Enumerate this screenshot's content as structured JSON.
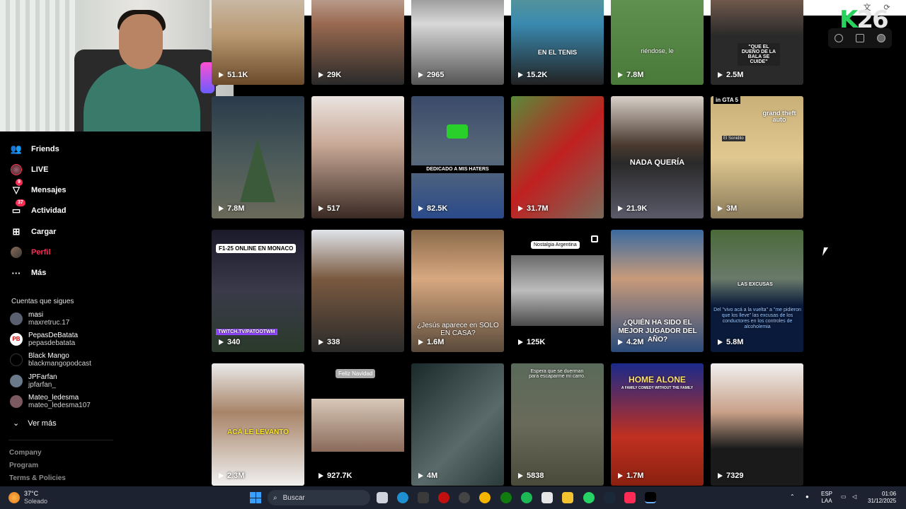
{
  "nav": {
    "friends": "Friends",
    "live": "LIVE",
    "messages": "Mensajes",
    "messages_badge": "9",
    "activity": "Actividad",
    "activity_badge": "37",
    "upload": "Cargar",
    "profile": "Perfil",
    "more": "Más"
  },
  "following": {
    "title": "Cuentas que sigues",
    "accounts": [
      {
        "name": "masi",
        "handle": "maxretruc.17"
      },
      {
        "name": "PepasDeBatata",
        "handle": "pepasdebatata"
      },
      {
        "name": "Black Mango",
        "handle": "blackmangopodcast"
      },
      {
        "name": "JPFarfan",
        "handle": "jpfarfan_"
      },
      {
        "name": "Mateo_ledesma",
        "handle": "mateo_ledesma107"
      }
    ],
    "see_more": "Ver más"
  },
  "footer": {
    "company": "Company",
    "program": "Program",
    "terms": "Terms & Policies"
  },
  "grid": {
    "row0": [
      "51.1K",
      "29K",
      "2965",
      "15.2K",
      "7.8M",
      "2.5M"
    ],
    "row1": [
      "7.8M",
      "517",
      "82.5K",
      "31.7M",
      "21.9K",
      "3M"
    ],
    "row2": [
      "340",
      "338",
      "1.6M",
      "125K",
      "4.2M",
      "5.8M"
    ],
    "row3": [
      "2.3M",
      "927.7K",
      "4M",
      "5838",
      "1.7M",
      "7329"
    ]
  },
  "captions": {
    "tenis": "EN EL TENIS",
    "riendose": "riéndose, le",
    "dueno": "\"QUE EL DUEÑO DE LA BALA SE CUIDE\"",
    "haters": "DEDICADO A MIS HATERS",
    "nada": "NADA QUERÍA",
    "gta": "in GTA 5",
    "gta_logo": "grand theft auto",
    "sonidito": "El Sonidito",
    "f1": "F1-25 ONLINE EN MONACO",
    "twitch": "TWITCH.TV/PATOOTWM",
    "jesus": "¿Jesús aparece en SOLO EN CASA?",
    "nostalgia": "Nostalgia Argentina",
    "quien": "¿QUIÉN HA SIDO EL MEJOR JUGADOR DEL AÑO?",
    "vivo": "Del \"vivo acá a la vuelta\" a \"me pidieron que los lleve\" las excusas de los conductores en los controles de alcoholemia",
    "excusas": "LAS EXCUSAS",
    "levanto": "ACÁ LE LEVANTO",
    "navidad": "Feliz Navidad",
    "espera": "Espera que se duerman para escaparme mi carro.",
    "home": "HOME ALONE",
    "home_sub": "A FAMILY COMEDY WITHOUT THE FAMILY"
  },
  "overlay": {
    "logo_k": "K",
    "logo_num": "26"
  },
  "taskbar": {
    "temp": "37°C",
    "weather": "Soleado",
    "search": "Buscar",
    "lang1": "ESP",
    "lang2": "LAA",
    "time": "01:06",
    "date": "31/12/2025"
  },
  "colors": {
    "accent": "#fe2c55",
    "taskbar": "#1c2230",
    "logo": "#27d35c"
  }
}
